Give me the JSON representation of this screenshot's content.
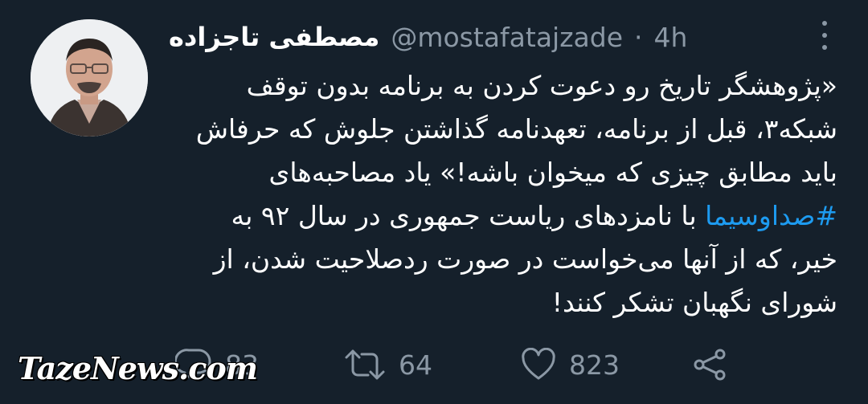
{
  "author": {
    "name": "مصطفی تاجزاده",
    "handle": "@mostafatajzade",
    "separator": "·",
    "time": "4h"
  },
  "tweet": {
    "lines": [
      "«پژوهشگر تاریخ رو دعوت کردن به برنامه بدون توقف",
      "شبکه۳، قبل از برنامه، تعهدنامه گذاشتن جلوش که حرفاش",
      "باید مطابق چیزی که میخوان باشه!» یاد مصاحبه‌های"
    ],
    "hashtag": "#صداوسیما",
    "line4_rest": " با نامزدهای ریاست جمهوری در سال ۹۲ به",
    "lines_after": [
      "خیر، که از آنها می‌خواست در صورت ردصلاحیت شدن، از",
      "شورای نگهبان تشکر کنند!"
    ]
  },
  "actions": {
    "reply_count": "83",
    "retweet_count": "64",
    "like_count": "823"
  },
  "icons": {
    "reply": "reply-icon",
    "retweet": "retweet-icon",
    "like": "heart-icon",
    "share": "share-icon",
    "more": "more-vertical-icon"
  },
  "watermark": "TazeNews.com",
  "colors": {
    "background": "#15202b",
    "text": "#ffffff",
    "secondary": "#8b98a5",
    "link": "#1d9bf0"
  }
}
